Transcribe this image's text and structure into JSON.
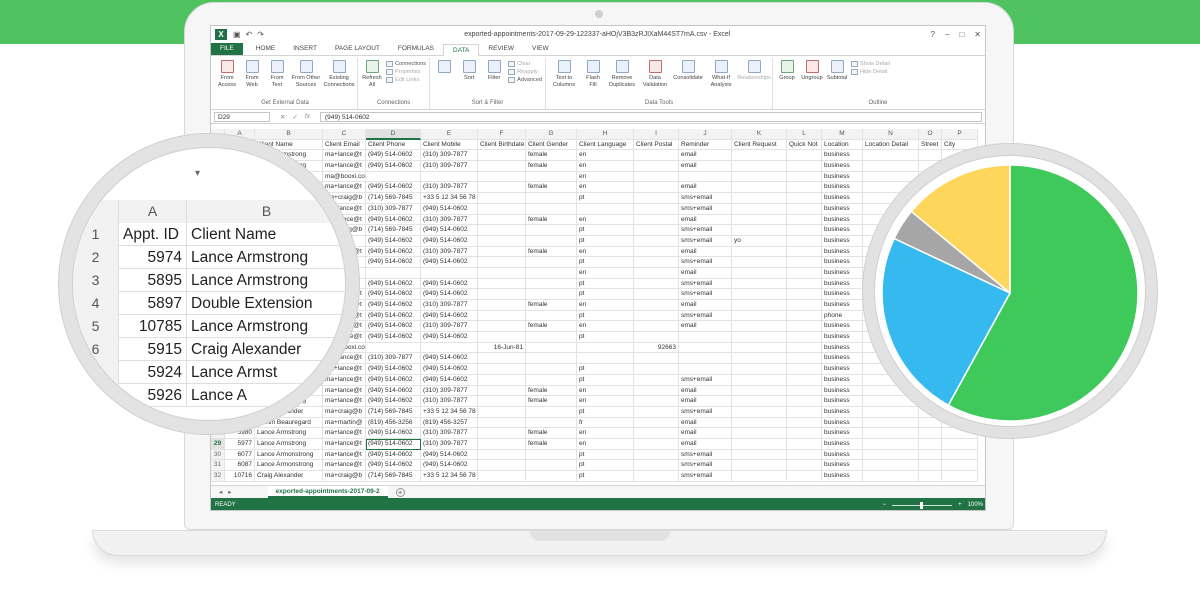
{
  "window": {
    "title": "exported-appointments-2017-09-29-122337-aHOjV3B3zRJIXaM44ST7mA.csv - Excel",
    "controls": [
      "?",
      "–",
      "□",
      "✕"
    ]
  },
  "tabs": [
    "FILE",
    "HOME",
    "INSERT",
    "PAGE LAYOUT",
    "FORMULAS",
    "DATA",
    "REVIEW",
    "VIEW"
  ],
  "active_tab": "DATA",
  "ribbon": {
    "get_external": {
      "label": "Get External Data",
      "buttons": [
        "From Access",
        "From Web",
        "From Text",
        "From Other Sources",
        "Existing Connections"
      ]
    },
    "connections": {
      "label": "Connections",
      "refresh": "Refresh All",
      "small": [
        "Connections",
        "Properties",
        "Edit Links"
      ]
    },
    "sort_filter": {
      "label": "Sort & Filter",
      "sort": "Sort",
      "filter": "Filter",
      "small": [
        "Clear",
        "Reapply",
        "Advanced"
      ]
    },
    "data_tools": {
      "label": "Data Tools",
      "buttons": [
        "Text to Columns",
        "Flash Fill",
        "Remove Duplicates",
        "Data Validation",
        "Consolidate",
        "What-If Analysis",
        "Relationships"
      ]
    },
    "outline": {
      "label": "Outline",
      "buttons": [
        "Group",
        "Ungroup",
        "Subtotal"
      ],
      "small": [
        "Show Detail",
        "Hide Detail"
      ]
    }
  },
  "formula_bar": {
    "name_box": "D29",
    "value": "(949) 514-0602"
  },
  "columns": [
    "A",
    "B",
    "C",
    "D",
    "E",
    "F",
    "G",
    "H",
    "I",
    "J",
    "K",
    "L",
    "M",
    "N",
    "O",
    "P"
  ],
  "headers": [
    "Appt. ID",
    "Client Name",
    "Client Email",
    "Client Phone",
    "Client Mobile",
    "Client Birthdate",
    "Client Gender",
    "Client Language",
    "Client Postal",
    "Reminder",
    "Client Request",
    "Quick Not",
    "Location",
    "Location Detail",
    "Street",
    "City"
  ],
  "rows": [
    [
      "2",
      "5974",
      "Lance Armstrong",
      "ma+lance@t",
      "(949) 514-0602",
      "(310) 309-7877",
      "",
      "female",
      "en",
      "",
      "email",
      "",
      "",
      "business",
      "",
      "",
      ""
    ],
    [
      "3",
      "5895",
      "Lance Armstrong",
      "ma+lance@t",
      "(949) 514-0602",
      "(310) 309-7877",
      "",
      "female",
      "en",
      "",
      "email",
      "",
      "",
      "business",
      "",
      "",
      ""
    ],
    [
      "4",
      "5897",
      "Double Extension",
      "ma@booxi.com.br",
      "",
      "",
      "",
      "",
      "en",
      "",
      "",
      "",
      "",
      "business",
      "",
      "",
      ""
    ],
    [
      "5",
      "10785",
      "Lance Armstrongg",
      "ma+lance@t",
      "(949) 514-0602",
      "(310) 309-7877",
      "",
      "female",
      "en",
      "",
      "email",
      "",
      "",
      "business",
      "",
      "",
      ""
    ],
    [
      "6",
      "5915",
      "Craig Alexander",
      "ma+craig@b",
      "(714) 569-7845",
      "+33 5 12 34 56 78",
      "",
      "",
      "pt",
      "",
      "sms+email",
      "",
      "",
      "business",
      "",
      "",
      ""
    ],
    [
      "7",
      "5924",
      "Lance Armstrong",
      "ma+lance@t",
      "(310) 309-7877",
      "(949) 514-0602",
      "",
      "",
      "",
      "",
      "sms+email",
      "",
      "",
      "business",
      "",
      "",
      ""
    ],
    [
      "8",
      "5926",
      "Lance Armstrong",
      "ma+lance@t",
      "(949) 514-0602",
      "(310) 309-7877",
      "",
      "female",
      "en",
      "",
      "email",
      "",
      "",
      "business",
      "",
      "",
      ""
    ],
    [
      "9",
      "5927",
      "Craig Alexander",
      "ma+craig@b",
      "(714) 569-7845",
      "(949) 514-0602",
      "",
      "",
      "pt",
      "",
      "sms+email",
      "",
      "",
      "business",
      "",
      "",
      ""
    ],
    [
      "10",
      "5928",
      "Lance Armstrong",
      "",
      "(949) 514-0602",
      "(949) 514-0602",
      "",
      "",
      "pt",
      "",
      "sms+email",
      "yo",
      "",
      "business",
      "",
      "",
      ""
    ],
    [
      "11",
      "5931",
      "Lance Armstrong",
      "ma+lance@t",
      "(949) 514-0602",
      "(310) 309-7877",
      "",
      "female",
      "en",
      "",
      "email",
      "",
      "",
      "business",
      "",
      "",
      ""
    ],
    [
      "12",
      "5933",
      "Lance Armstrong",
      "",
      "(949) 514-0602",
      "(949) 514-0602",
      "",
      "",
      "pt",
      "",
      "sms+email",
      "",
      "",
      "business",
      "",
      "",
      ""
    ],
    [
      "13",
      "5934",
      "Double Extension",
      "",
      "",
      "",
      "",
      "",
      "en",
      "",
      "email",
      "",
      "",
      "business",
      "",
      "",
      ""
    ],
    [
      "14",
      "5936",
      "Lance Armstrong",
      "",
      "(949) 514-0602",
      "(949) 514-0602",
      "",
      "",
      "pt",
      "",
      "sms+email",
      "",
      "",
      "business",
      "",
      "",
      ""
    ],
    [
      "15",
      "5937",
      "Lance Armstrong",
      "ma+lance@t",
      "(949) 514-0602",
      "(949) 514-0602",
      "",
      "",
      "pt",
      "",
      "sms+email",
      "",
      "",
      "business",
      "",
      "",
      ""
    ],
    [
      "16",
      "5938",
      "Lance Armstrong",
      "ma+lance@t",
      "(949) 514-0602",
      "(310) 309-7877",
      "",
      "female",
      "en",
      "",
      "email",
      "",
      "",
      "business",
      "",
      "",
      ""
    ],
    [
      "17",
      "5939",
      "Lance Armstrong",
      "ma+lance@t",
      "(949) 514-0602",
      "(949) 514-0602",
      "",
      "",
      "pt",
      "",
      "sms+email",
      "",
      "",
      "phone",
      "Yo, this",
      "",
      ""
    ],
    [
      "18",
      "5941",
      "Lance Armstrong",
      "ma+lance@t",
      "(949) 514-0602",
      "(310) 309-7877",
      "",
      "female",
      "en",
      "",
      "email",
      "",
      "",
      "business",
      "",
      "",
      ""
    ],
    [
      "19",
      "5942",
      "Lance Armstrong",
      "ma+lance@t",
      "(949) 514-0602",
      "(949) 514-0602",
      "",
      "",
      "pt",
      "",
      "",
      "",
      "",
      "business",
      "",
      "",
      ""
    ],
    [
      "20",
      "5943",
      "Double Extension",
      "ma@booxi.com",
      "",
      "",
      "16-Jun-81",
      "",
      "",
      "92663",
      "",
      "",
      "",
      "business",
      "",
      "",
      ""
    ],
    [
      "21",
      "5944",
      "Lance Armstrong",
      "ma+lance@t",
      "(310) 309-7877",
      "(949) 514-0602",
      "",
      "",
      "",
      "",
      "",
      "",
      "",
      "business",
      "",
      "",
      ""
    ],
    [
      "22",
      "5945",
      "Lance Armstrong",
      "ma+lance@t",
      "(949) 514-0602",
      "(949) 514-0602",
      "",
      "",
      "pt",
      "",
      "",
      "",
      "",
      "business",
      "",
      "",
      ""
    ],
    [
      "23",
      "5946",
      "Lance Armonstrong",
      "ma+lance@t",
      "(949) 514-0602",
      "(949) 514-0602",
      "",
      "",
      "pt",
      "",
      "sms+email",
      "",
      "",
      "business",
      "",
      "",
      ""
    ],
    [
      "24",
      "5947",
      "Lance Armstrong",
      "ma+lance@t",
      "(949) 514-0602",
      "(310) 309-7877",
      "",
      "female",
      "en",
      "",
      "email",
      "",
      "",
      "business",
      "",
      "",
      ""
    ],
    [
      "25",
      "5948",
      "Lance Armstrong",
      "ma+lance@t",
      "(949) 514-0602",
      "(310) 309-7877",
      "",
      "female",
      "en",
      "",
      "email",
      "",
      "",
      "business",
      "",
      "",
      ""
    ],
    [
      "26",
      "5978",
      "Craig Alexander",
      "ma+craig@b",
      "(714) 569-7845",
      "+33 5 12 34 56 78",
      "",
      "",
      "pt",
      "",
      "sms+email",
      "",
      "",
      "business",
      "",
      "",
      ""
    ],
    [
      "27",
      "5979",
      "Martin Beauregard",
      "ma+martin@",
      "(819) 456-3256",
      "(819) 456-3257",
      "",
      "",
      "fr",
      "",
      "email",
      "",
      "",
      "business",
      "",
      "",
      ""
    ],
    [
      "28",
      "5980",
      "Lance Armstrong",
      "ma+lance@t",
      "(949) 514-0602",
      "(310) 309-7877",
      "",
      "female",
      "en",
      "",
      "email",
      "",
      "",
      "business",
      "",
      "",
      ""
    ],
    [
      "29",
      "5977",
      "Lance Armstrong",
      "ma+lance@t",
      "(949) 514-0602",
      "(310) 309-7877",
      "",
      "female",
      "en",
      "",
      "email",
      "",
      "",
      "business",
      "",
      "",
      ""
    ],
    [
      "30",
      "6077",
      "Lance Armonstrong",
      "ma+lance@t",
      "(949) 514-0602",
      "(949) 514-0602",
      "",
      "",
      "pt",
      "",
      "sms+email",
      "",
      "",
      "business",
      "",
      "",
      ""
    ],
    [
      "31",
      "6087",
      "Lance Armonstrong",
      "ma+lance@t",
      "(949) 514-0602",
      "(949) 514-0602",
      "",
      "",
      "pt",
      "",
      "sms+email",
      "",
      "",
      "business",
      "",
      "",
      ""
    ],
    [
      "32",
      "10716",
      "Craig Alexander",
      "ma+craig@b",
      "(714) 569-7845",
      "+33 5 12 34 56 78",
      "",
      "",
      "pt",
      "",
      "sms+email",
      "",
      "",
      "business",
      "",
      "",
      ""
    ]
  ],
  "selected_row": "29",
  "selected_col": "D",
  "sheet_tab": "exported-appointments-2017-09-2",
  "status": {
    "ready": "READY",
    "zoom": "100%"
  },
  "magnifier": {
    "col_a": "A",
    "col_b": "B",
    "rows": [
      [
        "1",
        "Appt. ID",
        "Client Name"
      ],
      [
        "2",
        "5974",
        "Lance Armstrong"
      ],
      [
        "3",
        "5895",
        "Lance Armstrong"
      ],
      [
        "4",
        "5897",
        "Double Extension"
      ],
      [
        "5",
        "10785",
        "Lance Armstrong"
      ],
      [
        "6",
        "5915",
        "Craig Alexander"
      ],
      [
        "7",
        "5924",
        "Lance Armst"
      ],
      [
        "8",
        "5926",
        "Lance A"
      ]
    ]
  },
  "chart_data": {
    "type": "pie",
    "values": [
      58,
      24,
      4,
      14
    ],
    "colors": [
      "#3fc95a",
      "#36b9ee",
      "#a6a6a6",
      "#ffd65c"
    ],
    "title": ""
  }
}
